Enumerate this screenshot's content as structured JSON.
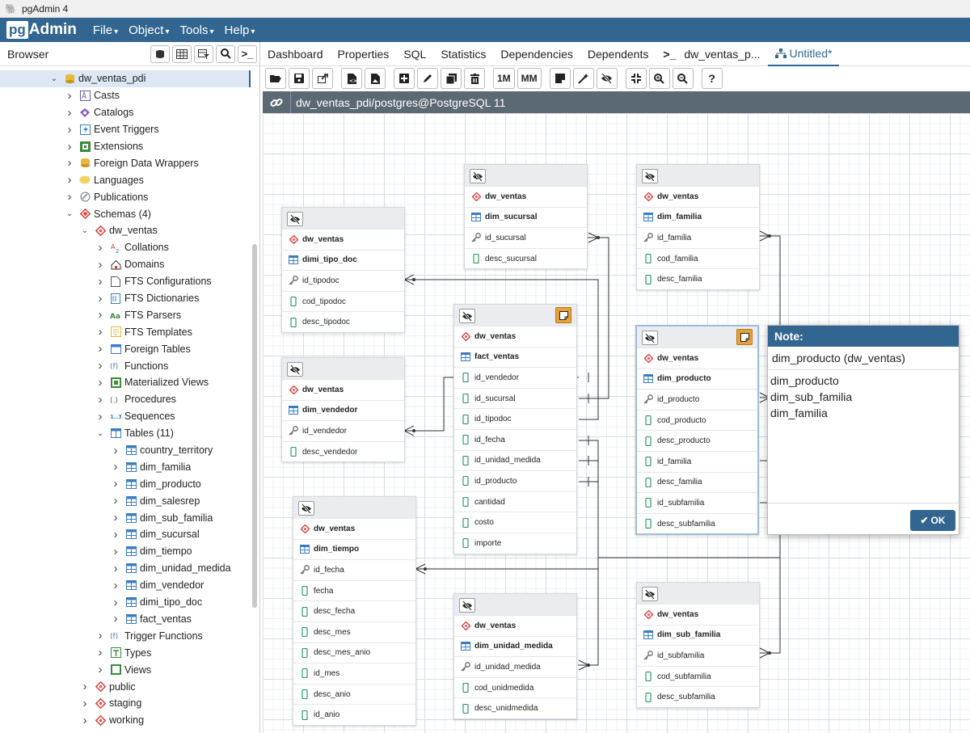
{
  "window": {
    "title": "pgAdmin 4"
  },
  "menubar": {
    "logo_pg": "pg",
    "logo_admin": "Admin",
    "items": [
      "File",
      "Object",
      "Tools",
      "Help"
    ]
  },
  "browser": {
    "label": "Browser",
    "tree": [
      {
        "label": "dw_ventas_pdi",
        "depth": 3,
        "expanded": true,
        "icon": "database-icon",
        "selected": true
      },
      {
        "label": "Casts",
        "depth": 4,
        "icon": "casts-icon"
      },
      {
        "label": "Catalogs",
        "depth": 4,
        "icon": "catalogs-icon"
      },
      {
        "label": "Event Triggers",
        "depth": 4,
        "icon": "event-triggers-icon"
      },
      {
        "label": "Extensions",
        "depth": 4,
        "icon": "extensions-icon"
      },
      {
        "label": "Foreign Data Wrappers",
        "depth": 4,
        "icon": "fdw-icon"
      },
      {
        "label": "Languages",
        "depth": 4,
        "icon": "languages-icon"
      },
      {
        "label": "Publications",
        "depth": 4,
        "icon": "publications-icon"
      },
      {
        "label": "Schemas (4)",
        "depth": 4,
        "expanded": true,
        "icon": "schemas-icon"
      },
      {
        "label": "dw_ventas",
        "depth": 5,
        "expanded": true,
        "icon": "schema-icon"
      },
      {
        "label": "Collations",
        "depth": 6,
        "icon": "collations-icon"
      },
      {
        "label": "Domains",
        "depth": 6,
        "icon": "domains-icon"
      },
      {
        "label": "FTS Configurations",
        "depth": 6,
        "icon": "fts-config-icon"
      },
      {
        "label": "FTS Dictionaries",
        "depth": 6,
        "icon": "fts-dict-icon"
      },
      {
        "label": "FTS Parsers",
        "depth": 6,
        "icon": "fts-parsers-icon"
      },
      {
        "label": "FTS Templates",
        "depth": 6,
        "icon": "fts-templates-icon"
      },
      {
        "label": "Foreign Tables",
        "depth": 6,
        "icon": "foreign-tables-icon"
      },
      {
        "label": "Functions",
        "depth": 6,
        "icon": "functions-icon"
      },
      {
        "label": "Materialized Views",
        "depth": 6,
        "icon": "mviews-icon"
      },
      {
        "label": "Procedures",
        "depth": 6,
        "icon": "procedures-icon"
      },
      {
        "label": "Sequences",
        "depth": 6,
        "icon": "sequences-icon"
      },
      {
        "label": "Tables (11)",
        "depth": 6,
        "expanded": true,
        "icon": "tables-icon"
      },
      {
        "label": "country_territory",
        "depth": 7,
        "icon": "table-icon"
      },
      {
        "label": "dim_familia",
        "depth": 7,
        "icon": "table-icon"
      },
      {
        "label": "dim_producto",
        "depth": 7,
        "icon": "table-icon"
      },
      {
        "label": "dim_salesrep",
        "depth": 7,
        "icon": "table-icon"
      },
      {
        "label": "dim_sub_familia",
        "depth": 7,
        "icon": "table-icon"
      },
      {
        "label": "dim_sucursal",
        "depth": 7,
        "icon": "table-icon"
      },
      {
        "label": "dim_tiempo",
        "depth": 7,
        "icon": "table-icon"
      },
      {
        "label": "dim_unidad_medida",
        "depth": 7,
        "icon": "table-icon"
      },
      {
        "label": "dim_vendedor",
        "depth": 7,
        "icon": "table-icon"
      },
      {
        "label": "dimi_tipo_doc",
        "depth": 7,
        "icon": "table-icon"
      },
      {
        "label": "fact_ventas",
        "depth": 7,
        "icon": "table-icon"
      },
      {
        "label": "Trigger Functions",
        "depth": 6,
        "icon": "trigger-functions-icon"
      },
      {
        "label": "Types",
        "depth": 6,
        "icon": "types-icon"
      },
      {
        "label": "Views",
        "depth": 6,
        "icon": "views-icon"
      },
      {
        "label": "public",
        "depth": 5,
        "icon": "schema-icon"
      },
      {
        "label": "staging",
        "depth": 5,
        "icon": "schema-icon"
      },
      {
        "label": "working",
        "depth": 5,
        "icon": "schema-icon"
      }
    ]
  },
  "tabs": [
    {
      "label": "Dashboard"
    },
    {
      "label": "Properties"
    },
    {
      "label": "SQL"
    },
    {
      "label": "Statistics"
    },
    {
      "label": "Dependencies"
    },
    {
      "label": "Dependents"
    },
    {
      "label": "dw_ventas_p...",
      "icon": "terminal-icon"
    },
    {
      "label": "Untitled*",
      "icon": "erd-icon",
      "active": true
    }
  ],
  "toolbar": {
    "buttons": [
      "open-file",
      "save",
      "save-as",
      "export-sql",
      "download-image",
      "add-table",
      "edit-table",
      "clone-table",
      "drop-table",
      "1M",
      "MM",
      "add-note",
      "auto-align",
      "hide-details",
      "zoom-fit",
      "zoom-in",
      "zoom-out",
      "help"
    ],
    "one_to_many": "1M",
    "many_to_many": "MM"
  },
  "connection": {
    "label": "dw_ventas_pdi/postgres@PostgreSQL 11"
  },
  "entities": [
    {
      "name": "dimi_tipo_doc",
      "schema": "dw_ventas",
      "columns": [
        {
          "name": "id_tipodoc",
          "pk": true
        },
        {
          "name": "cod_tipodoc"
        },
        {
          "name": "desc_tipodoc"
        }
      ]
    },
    {
      "name": "dim_vendedor",
      "schema": "dw_ventas",
      "columns": [
        {
          "name": "id_vendedor",
          "pk": true
        },
        {
          "name": "desc_vendedor"
        }
      ]
    },
    {
      "name": "dim_tiempo",
      "schema": "dw_ventas",
      "columns": [
        {
          "name": "id_fecha",
          "pk": true
        },
        {
          "name": "fecha"
        },
        {
          "name": "desc_fecha"
        },
        {
          "name": "desc_mes"
        },
        {
          "name": "desc_mes_anio"
        },
        {
          "name": "id_mes"
        },
        {
          "name": "desc_anio"
        },
        {
          "name": "id_anio"
        }
      ]
    },
    {
      "name": "dim_sucursal",
      "schema": "dw_ventas",
      "columns": [
        {
          "name": "id_sucursal",
          "pk": true
        },
        {
          "name": "desc_sucursal"
        }
      ]
    },
    {
      "name": "fact_ventas",
      "schema": "dw_ventas",
      "note": true,
      "columns": [
        {
          "name": "id_vendedor"
        },
        {
          "name": "id_sucursal"
        },
        {
          "name": "id_tipodoc"
        },
        {
          "name": "id_fecha"
        },
        {
          "name": "id_unidad_medida"
        },
        {
          "name": "id_producto"
        },
        {
          "name": "cantidad"
        },
        {
          "name": "costo"
        },
        {
          "name": "importe"
        }
      ]
    },
    {
      "name": "dim_unidad_medida",
      "schema": "dw_ventas",
      "columns": [
        {
          "name": "id_unidad_medida",
          "pk": true
        },
        {
          "name": "cod_unidmedida"
        },
        {
          "name": "desc_unidmedida"
        }
      ]
    },
    {
      "name": "dim_familia",
      "schema": "dw_ventas",
      "columns": [
        {
          "name": "id_familia",
          "pk": true
        },
        {
          "name": "cod_familia"
        },
        {
          "name": "desc_familia"
        }
      ]
    },
    {
      "name": "dim_producto",
      "schema": "dw_ventas",
      "note": true,
      "selected": true,
      "columns": [
        {
          "name": "id_producto",
          "pk": true
        },
        {
          "name": "cod_producto"
        },
        {
          "name": "desc_producto"
        },
        {
          "name": "id_familia"
        },
        {
          "name": "desc_familia"
        },
        {
          "name": "id_subfamilia"
        },
        {
          "name": "desc_subfamilia"
        }
      ]
    },
    {
      "name": "dim_sub_familia",
      "schema": "dw_ventas",
      "columns": [
        {
          "name": "id_subfamilia",
          "pk": true
        },
        {
          "name": "cod_subfamilia"
        },
        {
          "name": "desc_subfamilia"
        }
      ]
    }
  ],
  "note_dialog": {
    "title": "Note:",
    "subtitle": "dim_producto (dw_ventas)",
    "lines": [
      "dim_producto",
      "dim_sub_familia",
      "dim_familia"
    ],
    "ok_label": "OK"
  },
  "colors": {
    "brand": "#326690",
    "connection_bar": "#5b6975",
    "note_orange": "#e8a13a",
    "schema_red": "#d9413d"
  }
}
